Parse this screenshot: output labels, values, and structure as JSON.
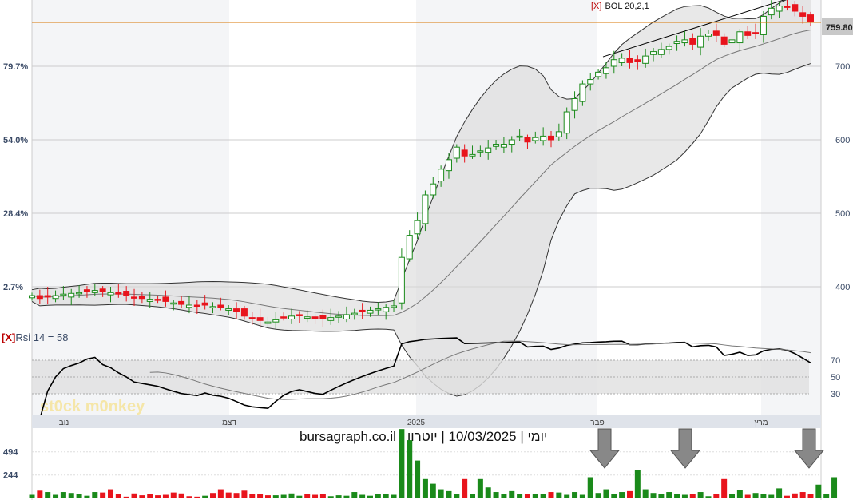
{
  "chart_data": {
    "type": "candlestick",
    "indicator_label": "BOL 20,2,1",
    "rsi_label": "Rsi 14 = 58",
    "close_marker": "[X]",
    "last_price": "759.80",
    "footer": "יומי | 10/03/2025 | יוטרון | bursagraph.co.il",
    "watermark": "st0ck m0nkey",
    "price_ticks": [
      400,
      500,
      600,
      700
    ],
    "pct_ticks": [
      "2.7%",
      "28.4%",
      "54.0%",
      "79.7%"
    ],
    "rsi_ticks": [
      30,
      50,
      70
    ],
    "volume_ticks": [
      244,
      494
    ],
    "months": [
      "נוב",
      "דצמ",
      "2025",
      "פבר",
      "מרץ"
    ],
    "closes": [
      388,
      384,
      386,
      388,
      390,
      391,
      392,
      394,
      395,
      393,
      392,
      390,
      388,
      385,
      384,
      383,
      382,
      380,
      378,
      376,
      375,
      374,
      375,
      373,
      372,
      370,
      366,
      360,
      356,
      354,
      352,
      355,
      358,
      360,
      361,
      359,
      357,
      356,
      358,
      360,
      362,
      364,
      366,
      368,
      370,
      372,
      374,
      440,
      470,
      490,
      525,
      540,
      560,
      573,
      590,
      578,
      580,
      585,
      589,
      594,
      594,
      600,
      605,
      597,
      603,
      605,
      600,
      611,
      638,
      656,
      676,
      682,
      692,
      698,
      709,
      711,
      705,
      706,
      714,
      720,
      723,
      727,
      734,
      736,
      730,
      741,
      744,
      742,
      730,
      736,
      747,
      742,
      745,
      768,
      779,
      782,
      780,
      775,
      768,
      760
    ],
    "volumes": [
      30,
      75,
      60,
      30,
      60,
      50,
      40,
      20,
      60,
      55,
      90,
      40,
      10,
      45,
      25,
      35,
      25,
      30,
      55,
      45,
      15,
      10,
      20,
      50,
      90,
      55,
      50,
      75,
      35,
      40,
      25,
      25,
      30,
      45,
      20,
      40,
      30,
      35,
      15,
      25,
      20,
      60,
      30,
      20,
      35,
      40,
      30,
      740,
      620,
      400,
      200,
      150,
      90,
      70,
      40,
      200,
      40,
      200,
      110,
      60,
      40,
      70,
      40,
      35,
      40,
      40,
      60,
      55,
      30,
      60,
      30,
      220,
      50,
      90,
      40,
      60,
      70,
      300,
      90,
      50,
      40,
      60,
      40,
      30,
      40,
      60,
      15,
      35,
      200,
      40,
      80,
      30,
      50,
      35,
      30,
      100,
      20,
      45,
      60,
      40,
      140,
      40,
      220
    ]
  },
  "colors": {
    "up": "#1a8a1a",
    "down": "#e8141c",
    "price_line": "#d97706",
    "band": "#d8d8d8"
  }
}
